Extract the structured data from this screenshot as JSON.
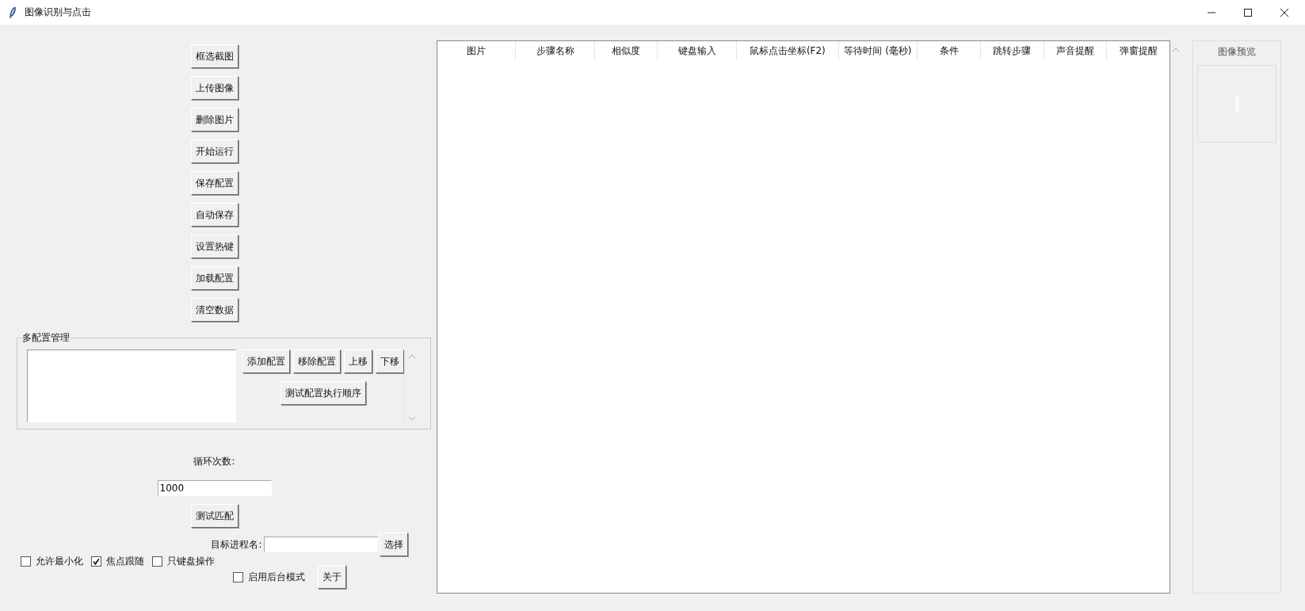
{
  "window": {
    "title": "图像识别与点击"
  },
  "actions": [
    "框选截图",
    "上传图像",
    "删除图片",
    "开始运行",
    "保存配置",
    "自动保存",
    "设置热键",
    "加载配置",
    "清空数据"
  ],
  "config_group": {
    "title": "多配置管理",
    "buttons": [
      "添加配置",
      "移除配置",
      "上移",
      "下移"
    ],
    "order_button": "测试配置执行顺序"
  },
  "loop": {
    "label": "循环次数:",
    "value": "1000"
  },
  "test_match_button": "测试匹配",
  "target_process": {
    "label": "目标进程名:",
    "button": "选择"
  },
  "options": [
    {
      "label": "允许最小化",
      "checked": false
    },
    {
      "label": "焦点跟随",
      "checked": true
    },
    {
      "label": "只键盘操作",
      "checked": false
    }
  ],
  "background_mode": {
    "label": "启用后台模式",
    "checked": false
  },
  "about_button": "关于",
  "table": {
    "columns": [
      "图片",
      "步骤名称",
      "相似度",
      "键盘输入",
      "鼠标点击坐标(F2)",
      "等待时间 (毫秒)",
      "条件",
      "跳转步骤",
      "声音提醒",
      "弹窗提醒"
    ]
  },
  "preview": {
    "title": "图像预览"
  }
}
